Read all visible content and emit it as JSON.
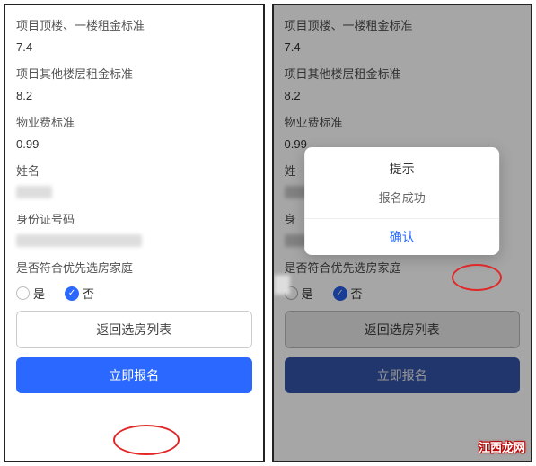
{
  "left": {
    "fields": {
      "top_floor_rent_label": "项目顶楼、一楼租金标准",
      "top_floor_rent_value": "7.4",
      "other_floor_rent_label": "项目其他楼层租金标准",
      "other_floor_rent_value": "8.2",
      "property_fee_label": "物业费标准",
      "property_fee_value": "0.99",
      "name_label": "姓名",
      "id_label": "身份证号码",
      "priority_label": "是否符合优先选房家庭"
    },
    "radio": {
      "yes": "是",
      "no": "否"
    },
    "buttons": {
      "back": "返回选房列表",
      "submit": "立即报名"
    }
  },
  "right": {
    "fields": {
      "top_floor_rent_label": "项目顶楼、一楼租金标准",
      "top_floor_rent_value": "7.4",
      "other_floor_rent_label": "项目其他楼层租金标准",
      "other_floor_rent_value": "8.2",
      "property_fee_label": "物业费标准",
      "property_fee_value": "0.99",
      "name_label": "姓",
      "id_label": "身",
      "priority_label": "是否符合优先选房家庭"
    },
    "radio": {
      "yes": "是",
      "no": "否"
    },
    "buttons": {
      "back": "返回选房列表",
      "submit": "立即报名"
    },
    "modal": {
      "title": "提示",
      "body": "报名成功",
      "confirm": "确认"
    }
  },
  "watermark": "江西龙网"
}
